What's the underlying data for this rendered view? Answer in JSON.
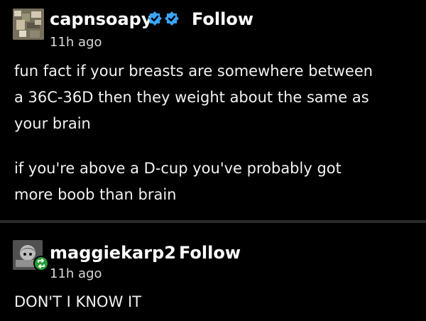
{
  "posts": [
    {
      "username": "capnsoapy",
      "verified_badges": [
        "verified-badge-icon",
        "verified-badge-icon"
      ],
      "follow_label": "Follow",
      "timestamp": "11h ago",
      "paragraphs": [
        [
          "fun fact if your breasts are somewhere between",
          "a 36C-36D then they weight about the same as",
          "your brain"
        ],
        [
          "if you're above a D-cup you've probably got",
          "more boob than brain"
        ]
      ]
    },
    {
      "username": "maggiekarp2",
      "follow_label": "Follow",
      "timestamp": "11h ago",
      "reblog_icon": "reblog-icon",
      "paragraphs": [
        [
          "DON'T I KNOW IT"
        ]
      ]
    }
  ],
  "colors": {
    "background": "#000000",
    "text": "#ffffff",
    "verified_blue": "#3aa4ff",
    "reblog_green": "#2b9e39"
  }
}
